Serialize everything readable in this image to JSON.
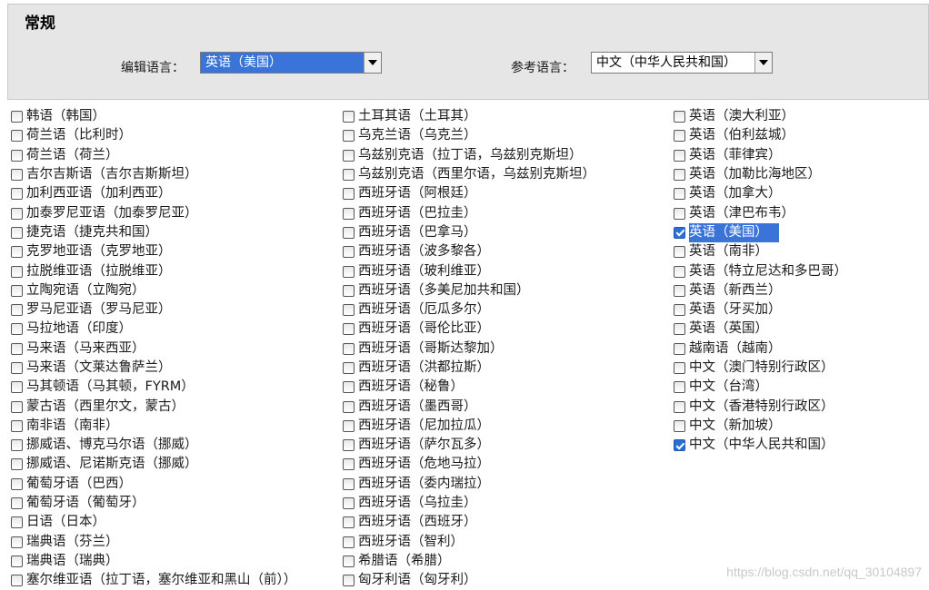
{
  "section_title": "常规",
  "edit_language": {
    "label": "编辑语言：",
    "value": "英语（美国）"
  },
  "reference_language": {
    "label": "参考语言：",
    "value": "中文（中华人民共和国）"
  },
  "columns": [
    [
      {
        "label": "韩语（韩国）",
        "checked": false
      },
      {
        "label": "荷兰语（比利时）",
        "checked": false
      },
      {
        "label": "荷兰语（荷兰）",
        "checked": false
      },
      {
        "label": "吉尔吉斯语（吉尔吉斯斯坦）",
        "checked": false
      },
      {
        "label": "加利西亚语（加利西亚）",
        "checked": false
      },
      {
        "label": "加泰罗尼亚语（加泰罗尼亚）",
        "checked": false
      },
      {
        "label": "捷克语（捷克共和国）",
        "checked": false
      },
      {
        "label": "克罗地亚语（克罗地亚）",
        "checked": false
      },
      {
        "label": "拉脱维亚语（拉脱维亚）",
        "checked": false
      },
      {
        "label": "立陶宛语（立陶宛）",
        "checked": false
      },
      {
        "label": "罗马尼亚语（罗马尼亚）",
        "checked": false
      },
      {
        "label": "马拉地语（印度）",
        "checked": false
      },
      {
        "label": "马来语（马来西亚）",
        "checked": false
      },
      {
        "label": "马来语（文莱达鲁萨兰）",
        "checked": false
      },
      {
        "label": "马其顿语（马其顿，FYRM）",
        "checked": false
      },
      {
        "label": "蒙古语（西里尔文，蒙古）",
        "checked": false
      },
      {
        "label": "南非语（南非）",
        "checked": false
      },
      {
        "label": "挪威语、博克马尔语（挪威）",
        "checked": false
      },
      {
        "label": "挪威语、尼诺斯克语（挪威）",
        "checked": false
      },
      {
        "label": "葡萄牙语（巴西）",
        "checked": false
      },
      {
        "label": "葡萄牙语（葡萄牙）",
        "checked": false
      },
      {
        "label": "日语（日本）",
        "checked": false
      },
      {
        "label": "瑞典语（芬兰）",
        "checked": false
      },
      {
        "label": "瑞典语（瑞典）",
        "checked": false
      },
      {
        "label": "塞尔维亚语（拉丁语，塞尔维亚和黑山（前））",
        "checked": false
      }
    ],
    [
      {
        "label": "土耳其语（土耳其）",
        "checked": false
      },
      {
        "label": "乌克兰语（乌克兰）",
        "checked": false
      },
      {
        "label": "乌兹别克语（拉丁语，乌兹别克斯坦）",
        "checked": false
      },
      {
        "label": "乌兹别克语（西里尔语，乌兹别克斯坦）",
        "checked": false
      },
      {
        "label": "西班牙语（阿根廷）",
        "checked": false
      },
      {
        "label": "西班牙语（巴拉圭）",
        "checked": false
      },
      {
        "label": "西班牙语（巴拿马）",
        "checked": false
      },
      {
        "label": "西班牙语（波多黎各）",
        "checked": false
      },
      {
        "label": "西班牙语（玻利维亚）",
        "checked": false
      },
      {
        "label": "西班牙语（多美尼加共和国）",
        "checked": false
      },
      {
        "label": "西班牙语（厄瓜多尔）",
        "checked": false
      },
      {
        "label": "西班牙语（哥伦比亚）",
        "checked": false
      },
      {
        "label": "西班牙语（哥斯达黎加）",
        "checked": false
      },
      {
        "label": "西班牙语（洪都拉斯）",
        "checked": false
      },
      {
        "label": "西班牙语（秘鲁）",
        "checked": false
      },
      {
        "label": "西班牙语（墨西哥）",
        "checked": false
      },
      {
        "label": "西班牙语（尼加拉瓜）",
        "checked": false
      },
      {
        "label": "西班牙语（萨尔瓦多）",
        "checked": false
      },
      {
        "label": "西班牙语（危地马拉）",
        "checked": false
      },
      {
        "label": "西班牙语（委内瑞拉）",
        "checked": false
      },
      {
        "label": "西班牙语（乌拉圭）",
        "checked": false
      },
      {
        "label": "西班牙语（西班牙）",
        "checked": false
      },
      {
        "label": "西班牙语（智利）",
        "checked": false
      },
      {
        "label": "希腊语（希腊）",
        "checked": false
      },
      {
        "label": "匈牙利语（匈牙利）",
        "checked": false
      }
    ],
    [
      {
        "label": "英语（澳大利亚）",
        "checked": false
      },
      {
        "label": "英语（伯利兹城）",
        "checked": false
      },
      {
        "label": "英语（菲律宾）",
        "checked": false
      },
      {
        "label": "英语（加勒比海地区）",
        "checked": false
      },
      {
        "label": "英语（加拿大）",
        "checked": false
      },
      {
        "label": "英语（津巴布韦）",
        "checked": false
      },
      {
        "label": "英语（美国）",
        "checked": true,
        "highlight": true
      },
      {
        "label": "英语（南非）",
        "checked": false
      },
      {
        "label": "英语（特立尼达和多巴哥）",
        "checked": false
      },
      {
        "label": "英语（新西兰）",
        "checked": false
      },
      {
        "label": "英语（牙买加）",
        "checked": false
      },
      {
        "label": "英语（英国）",
        "checked": false
      },
      {
        "label": "越南语（越南）",
        "checked": false
      },
      {
        "label": "中文（澳门特别行政区）",
        "checked": false
      },
      {
        "label": "中文（台湾）",
        "checked": false
      },
      {
        "label": "中文（香港特别行政区）",
        "checked": false
      },
      {
        "label": "中文（新加坡）",
        "checked": false
      },
      {
        "label": "中文（中华人民共和国）",
        "checked": true
      }
    ]
  ],
  "watermark": "https://blog.csdn.net/qq_30104897",
  "colors": {
    "accent": "#3a74d8",
    "panel": "#e6e6e6"
  }
}
